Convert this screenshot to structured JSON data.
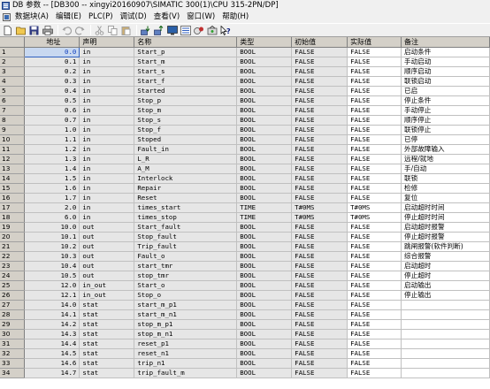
{
  "window": {
    "title": "DB 参数 -- [DB300 -- xingyi20160907\\SIMATIC 300(1)\\CPU 315-2PN/DP]"
  },
  "menu": {
    "items": [
      "数据块(A)",
      "编辑(E)",
      "PLC(P)",
      "调试(D)",
      "查看(V)",
      "窗口(W)",
      "帮助(H)"
    ]
  },
  "toolbar": {
    "buttons": [
      "new-icon",
      "open-icon",
      "save-icon",
      "print-icon",
      "undo-icon",
      "redo-icon",
      "cut-icon",
      "copy-icon",
      "paste-icon",
      "download-icon",
      "upload-icon",
      "monitor-icon",
      "monitor-db-icon",
      "goto-icon",
      "online-icon",
      "help-icon"
    ]
  },
  "table": {
    "headers": [
      "地址",
      "声明",
      "名称",
      "类型",
      "初始值",
      "实际值",
      "备注"
    ],
    "rows": [
      [
        "1",
        "0.0",
        "in",
        "Start_p",
        "BOOL",
        "FALSE",
        "FALSE",
        "启动条件"
      ],
      [
        "2",
        "0.1",
        "in",
        "Start_m",
        "BOOL",
        "FALSE",
        "FALSE",
        "手动启动"
      ],
      [
        "3",
        "0.2",
        "in",
        "Start_s",
        "BOOL",
        "FALSE",
        "FALSE",
        "顺序启动"
      ],
      [
        "4",
        "0.3",
        "in",
        "Start_f",
        "BOOL",
        "FALSE",
        "FALSE",
        "联锁启动"
      ],
      [
        "5",
        "0.4",
        "in",
        "Started",
        "BOOL",
        "FALSE",
        "FALSE",
        "已启"
      ],
      [
        "6",
        "0.5",
        "in",
        "Stop_p",
        "BOOL",
        "FALSE",
        "FALSE",
        "停止条件"
      ],
      [
        "7",
        "0.6",
        "in",
        "Stop_m",
        "BOOL",
        "FALSE",
        "FALSE",
        "手动停止"
      ],
      [
        "8",
        "0.7",
        "in",
        "Stop_s",
        "BOOL",
        "FALSE",
        "FALSE",
        "顺序停止"
      ],
      [
        "9",
        "1.0",
        "in",
        "Stop_f",
        "BOOL",
        "FALSE",
        "FALSE",
        "联锁停止"
      ],
      [
        "10",
        "1.1",
        "in",
        "Stoped",
        "BOOL",
        "FALSE",
        "FALSE",
        "已停"
      ],
      [
        "11",
        "1.2",
        "in",
        "Fault_in",
        "BOOL",
        "FALSE",
        "FALSE",
        "外部故障输入"
      ],
      [
        "12",
        "1.3",
        "in",
        "L_R",
        "BOOL",
        "FALSE",
        "FALSE",
        "远程/就地"
      ],
      [
        "13",
        "1.4",
        "in",
        "A_M",
        "BOOL",
        "FALSE",
        "FALSE",
        "手/自动"
      ],
      [
        "14",
        "1.5",
        "in",
        "Interlock",
        "BOOL",
        "FALSE",
        "FALSE",
        "联锁"
      ],
      [
        "15",
        "1.6",
        "in",
        "Repair",
        "BOOL",
        "FALSE",
        "FALSE",
        "检修"
      ],
      [
        "16",
        "1.7",
        "in",
        "Reset",
        "BOOL",
        "FALSE",
        "FALSE",
        "复位"
      ],
      [
        "17",
        "2.0",
        "in",
        "times_start",
        "TIME",
        "T#0MS",
        "T#0MS",
        "启动超时时间"
      ],
      [
        "18",
        "6.0",
        "in",
        "times_stop",
        "TIME",
        "T#0MS",
        "T#0MS",
        "停止超时时间"
      ],
      [
        "19",
        "10.0",
        "out",
        "Start_fault",
        "BOOL",
        "FALSE",
        "FALSE",
        "启动超时报警"
      ],
      [
        "20",
        "10.1",
        "out",
        "Stop_fault",
        "BOOL",
        "FALSE",
        "FALSE",
        "停止超时报警"
      ],
      [
        "21",
        "10.2",
        "out",
        "Trip_fault",
        "BOOL",
        "FALSE",
        "FALSE",
        "跳闸报警(软件判断)"
      ],
      [
        "22",
        "10.3",
        "out",
        "Fault_o",
        "BOOL",
        "FALSE",
        "FALSE",
        "综合报警"
      ],
      [
        "23",
        "10.4",
        "out",
        "start_tmr",
        "BOOL",
        "FALSE",
        "FALSE",
        "启动超时"
      ],
      [
        "24",
        "10.5",
        "out",
        "stop_tmr",
        "BOOL",
        "FALSE",
        "FALSE",
        "停止超时"
      ],
      [
        "25",
        "12.0",
        "in_out",
        "Start_o",
        "BOOL",
        "FALSE",
        "FALSE",
        "启动输出"
      ],
      [
        "26",
        "12.1",
        "in_out",
        "Stop_o",
        "BOOL",
        "FALSE",
        "FALSE",
        "停止输出"
      ],
      [
        "27",
        "14.0",
        "stat",
        "start_m_p1",
        "BOOL",
        "FALSE",
        "FALSE",
        ""
      ],
      [
        "28",
        "14.1",
        "stat",
        "start_m_n1",
        "BOOL",
        "FALSE",
        "FALSE",
        ""
      ],
      [
        "29",
        "14.2",
        "stat",
        "stop_m_p1",
        "BOOL",
        "FALSE",
        "FALSE",
        ""
      ],
      [
        "30",
        "14.3",
        "stat",
        "stop_m_n1",
        "BOOL",
        "FALSE",
        "FALSE",
        ""
      ],
      [
        "31",
        "14.4",
        "stat",
        "reset_p1",
        "BOOL",
        "FALSE",
        "FALSE",
        ""
      ],
      [
        "32",
        "14.5",
        "stat",
        "reset_n1",
        "BOOL",
        "FALSE",
        "FALSE",
        ""
      ],
      [
        "33",
        "14.6",
        "stat",
        "trip_n1",
        "BOOL",
        "FALSE",
        "FALSE",
        ""
      ],
      [
        "34",
        "14.7",
        "stat",
        "trip_fault_m",
        "BOOL",
        "FALSE",
        "FALSE",
        ""
      ]
    ]
  }
}
